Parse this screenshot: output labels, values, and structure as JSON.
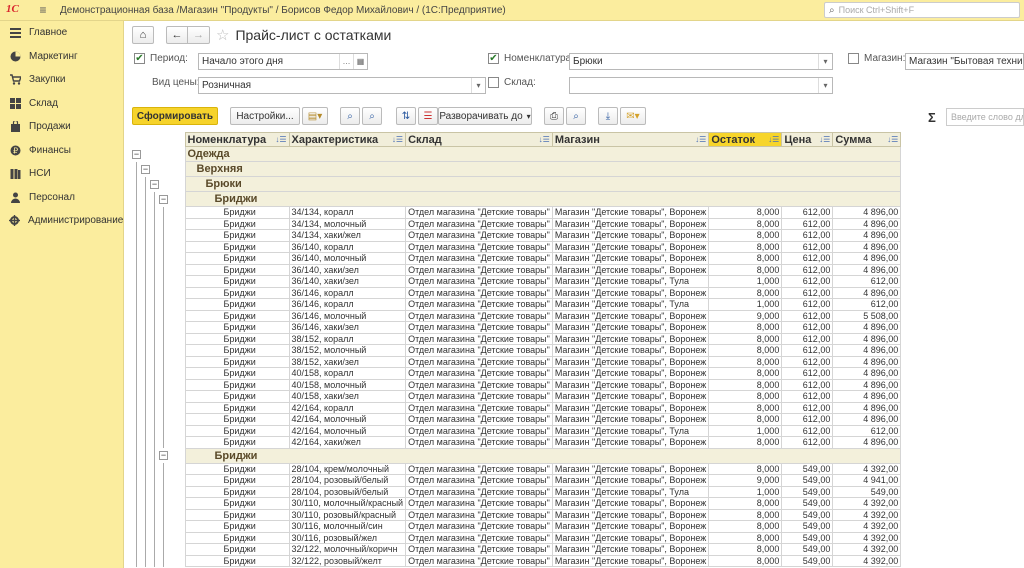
{
  "titlebar": {
    "logo": "1С",
    "title": "Демонстрационная база /Магазин \"Продукты\" / Борисов Федор Михайлович /  (1С:Предприятие)",
    "search_placeholder": "Поиск Ctrl+Shift+F"
  },
  "sidebar": {
    "items": [
      {
        "label": "Главное",
        "icon": "menu-icon"
      },
      {
        "label": "Маркетинг",
        "icon": "pie-chart-icon"
      },
      {
        "label": "Закупки",
        "icon": "cart-icon"
      },
      {
        "label": "Склад",
        "icon": "warehouse-icon"
      },
      {
        "label": "Продажи",
        "icon": "bag-icon"
      },
      {
        "label": "Финансы",
        "icon": "coins-icon"
      },
      {
        "label": "НСИ",
        "icon": "books-icon"
      },
      {
        "label": "Персонал",
        "icon": "person-icon"
      },
      {
        "label": "Администрирование",
        "icon": "gear-icon"
      }
    ]
  },
  "header": {
    "title": "Прайс-лист с остатками",
    "home_icon": "home-icon",
    "back_icon": "back-arrow-icon",
    "forward_icon": "forward-arrow-icon",
    "favorite_icon": "star-icon"
  },
  "filters": {
    "period_label": "Период:",
    "period_value": "Начало этого дня",
    "period_checked": true,
    "price_type_label": "Вид цены:",
    "price_type_value": "Розничная",
    "nomenclature_label": "Номенклатура:",
    "nomenclature_value": "Брюки",
    "nomenclature_checked": true,
    "warehouse_label": "Склад:",
    "warehouse_value": "",
    "warehouse_checked": false,
    "shop_label": "Магазин:",
    "shop_value": "Магазин \"Бытовая техника\"",
    "shop_checked": false
  },
  "toolbar": {
    "generate_label": "Сформировать",
    "settings_label": "Настройки...",
    "expand_label": "Разворачивать до",
    "sigma": "Σ",
    "search_placeholder": "Введите слово для"
  },
  "report": {
    "columns": [
      {
        "label": "Номенклатура",
        "highlight": false
      },
      {
        "label": "Характеристика",
        "highlight": false
      },
      {
        "label": "Склад",
        "highlight": false
      },
      {
        "label": "Магазин",
        "highlight": false
      },
      {
        "label": "Остаток",
        "highlight": true
      },
      {
        "label": "Цена",
        "highlight": false
      },
      {
        "label": "Сумма",
        "highlight": false
      }
    ],
    "groups": [
      {
        "label": "Одежда",
        "level": 0
      },
      {
        "label": "Верхняя",
        "level": 1
      },
      {
        "label": "Брюки",
        "level": 2
      },
      {
        "label": "Бриджи",
        "level": 3
      }
    ],
    "group2_label": "Бриджи",
    "rows1": [
      [
        "Бриджи",
        "34/134, коралл",
        "Отдел магазина \"Детские товары\"",
        "Магазин \"Детские товары\", Воронеж",
        "8,000",
        "612,00",
        "4 896,00"
      ],
      [
        "Бриджи",
        "34/134, молочный",
        "Отдел магазина \"Детские товары\"",
        "Магазин \"Детские товары\", Воронеж",
        "8,000",
        "612,00",
        "4 896,00"
      ],
      [
        "Бриджи",
        "34/134, хаки/жел",
        "Отдел магазина \"Детские товары\"",
        "Магазин \"Детские товары\", Воронеж",
        "8,000",
        "612,00",
        "4 896,00"
      ],
      [
        "Бриджи",
        "36/140, коралл",
        "Отдел магазина \"Детские товары\"",
        "Магазин \"Детские товары\", Воронеж",
        "8,000",
        "612,00",
        "4 896,00"
      ],
      [
        "Бриджи",
        "36/140, молочный",
        "Отдел магазина \"Детские товары\"",
        "Магазин \"Детские товары\", Воронеж",
        "8,000",
        "612,00",
        "4 896,00"
      ],
      [
        "Бриджи",
        "36/140, хаки/зел",
        "Отдел магазина \"Детские товары\"",
        "Магазин \"Детские товары\", Воронеж",
        "8,000",
        "612,00",
        "4 896,00"
      ],
      [
        "Бриджи",
        "36/140, хаки/зел",
        "Отдел магазина \"Детские товары\"",
        "Магазин \"Детские товары\", Тула",
        "1,000",
        "612,00",
        "612,00"
      ],
      [
        "Бриджи",
        "36/146, коралл",
        "Отдел магазина \"Детские товары\"",
        "Магазин \"Детские товары\", Воронеж",
        "8,000",
        "612,00",
        "4 896,00"
      ],
      [
        "Бриджи",
        "36/146, коралл",
        "Отдел магазина \"Детские товары\"",
        "Магазин \"Детские товары\", Тула",
        "1,000",
        "612,00",
        "612,00"
      ],
      [
        "Бриджи",
        "36/146, молочный",
        "Отдел магазина \"Детские товары\"",
        "Магазин \"Детские товары\", Воронеж",
        "9,000",
        "612,00",
        "5 508,00"
      ],
      [
        "Бриджи",
        "36/146, хаки/зел",
        "Отдел магазина \"Детские товары\"",
        "Магазин \"Детские товары\", Воронеж",
        "8,000",
        "612,00",
        "4 896,00"
      ],
      [
        "Бриджи",
        "38/152, коралл",
        "Отдел магазина \"Детские товары\"",
        "Магазин \"Детские товары\", Воронеж",
        "8,000",
        "612,00",
        "4 896,00"
      ],
      [
        "Бриджи",
        "38/152, молочный",
        "Отдел магазина \"Детские товары\"",
        "Магазин \"Детские товары\", Воронеж",
        "8,000",
        "612,00",
        "4 896,00"
      ],
      [
        "Бриджи",
        "38/152, хаки/зел",
        "Отдел магазина \"Детские товары\"",
        "Магазин \"Детские товары\", Воронеж",
        "8,000",
        "612,00",
        "4 896,00"
      ],
      [
        "Бриджи",
        "40/158, коралл",
        "Отдел магазина \"Детские товары\"",
        "Магазин \"Детские товары\", Воронеж",
        "8,000",
        "612,00",
        "4 896,00"
      ],
      [
        "Бриджи",
        "40/158, молочный",
        "Отдел магазина \"Детские товары\"",
        "Магазин \"Детские товары\", Воронеж",
        "8,000",
        "612,00",
        "4 896,00"
      ],
      [
        "Бриджи",
        "40/158, хаки/зел",
        "Отдел магазина \"Детские товары\"",
        "Магазин \"Детские товары\", Воронеж",
        "8,000",
        "612,00",
        "4 896,00"
      ],
      [
        "Бриджи",
        "42/164, коралл",
        "Отдел магазина \"Детские товары\"",
        "Магазин \"Детские товары\", Воронеж",
        "8,000",
        "612,00",
        "4 896,00"
      ],
      [
        "Бриджи",
        "42/164, молочный",
        "Отдел магазина \"Детские товары\"",
        "Магазин \"Детские товары\", Воронеж",
        "8,000",
        "612,00",
        "4 896,00"
      ],
      [
        "Бриджи",
        "42/164, молочный",
        "Отдел магазина \"Детские товары\"",
        "Магазин \"Детские товары\", Тула",
        "1,000",
        "612,00",
        "612,00"
      ],
      [
        "Бриджи",
        "42/164, хаки/жел",
        "Отдел магазина \"Детские товары\"",
        "Магазин \"Детские товары\", Воронеж",
        "8,000",
        "612,00",
        "4 896,00"
      ]
    ],
    "rows2": [
      [
        "Бриджи",
        "28/104, крем/молочный",
        "Отдел магазина \"Детские товары\"",
        "Магазин \"Детские товары\", Воронеж",
        "8,000",
        "549,00",
        "4 392,00"
      ],
      [
        "Бриджи",
        "28/104, розовый/белый",
        "Отдел магазина \"Детские товары\"",
        "Магазин \"Детские товары\", Воронеж",
        "9,000",
        "549,00",
        "4 941,00"
      ],
      [
        "Бриджи",
        "28/104, розовый/белый",
        "Отдел магазина \"Детские товары\"",
        "Магазин \"Детские товары\", Тула",
        "1,000",
        "549,00",
        "549,00"
      ],
      [
        "Бриджи",
        "30/110, молочный/красный",
        "Отдел магазина \"Детские товары\"",
        "Магазин \"Детские товары\", Воронеж",
        "8,000",
        "549,00",
        "4 392,00"
      ],
      [
        "Бриджи",
        "30/110, розовый/красный",
        "Отдел магазина \"Детские товары\"",
        "Магазин \"Детские товары\", Воронеж",
        "8,000",
        "549,00",
        "4 392,00"
      ],
      [
        "Бриджи",
        "30/116, молочный/син",
        "Отдел магазина \"Детские товары\"",
        "Магазин \"Детские товары\", Воронеж",
        "8,000",
        "549,00",
        "4 392,00"
      ],
      [
        "Бриджи",
        "30/116, розовый/жел",
        "Отдел магазина \"Детские товары\"",
        "Магазин \"Детские товары\", Воронеж",
        "8,000",
        "549,00",
        "4 392,00"
      ],
      [
        "Бриджи",
        "32/122, молочный/коричн",
        "Отдел магазина \"Детские товары\"",
        "Магазин \"Детские товары\", Воронеж",
        "8,000",
        "549,00",
        "4 392,00"
      ],
      [
        "Бриджи",
        "32/122, розовый/желт",
        "Отдел магазина \"Детские товары\"",
        "Магазин \"Детские товары\", Воронеж",
        "8,000",
        "549,00",
        "4 392,00"
      ]
    ]
  }
}
